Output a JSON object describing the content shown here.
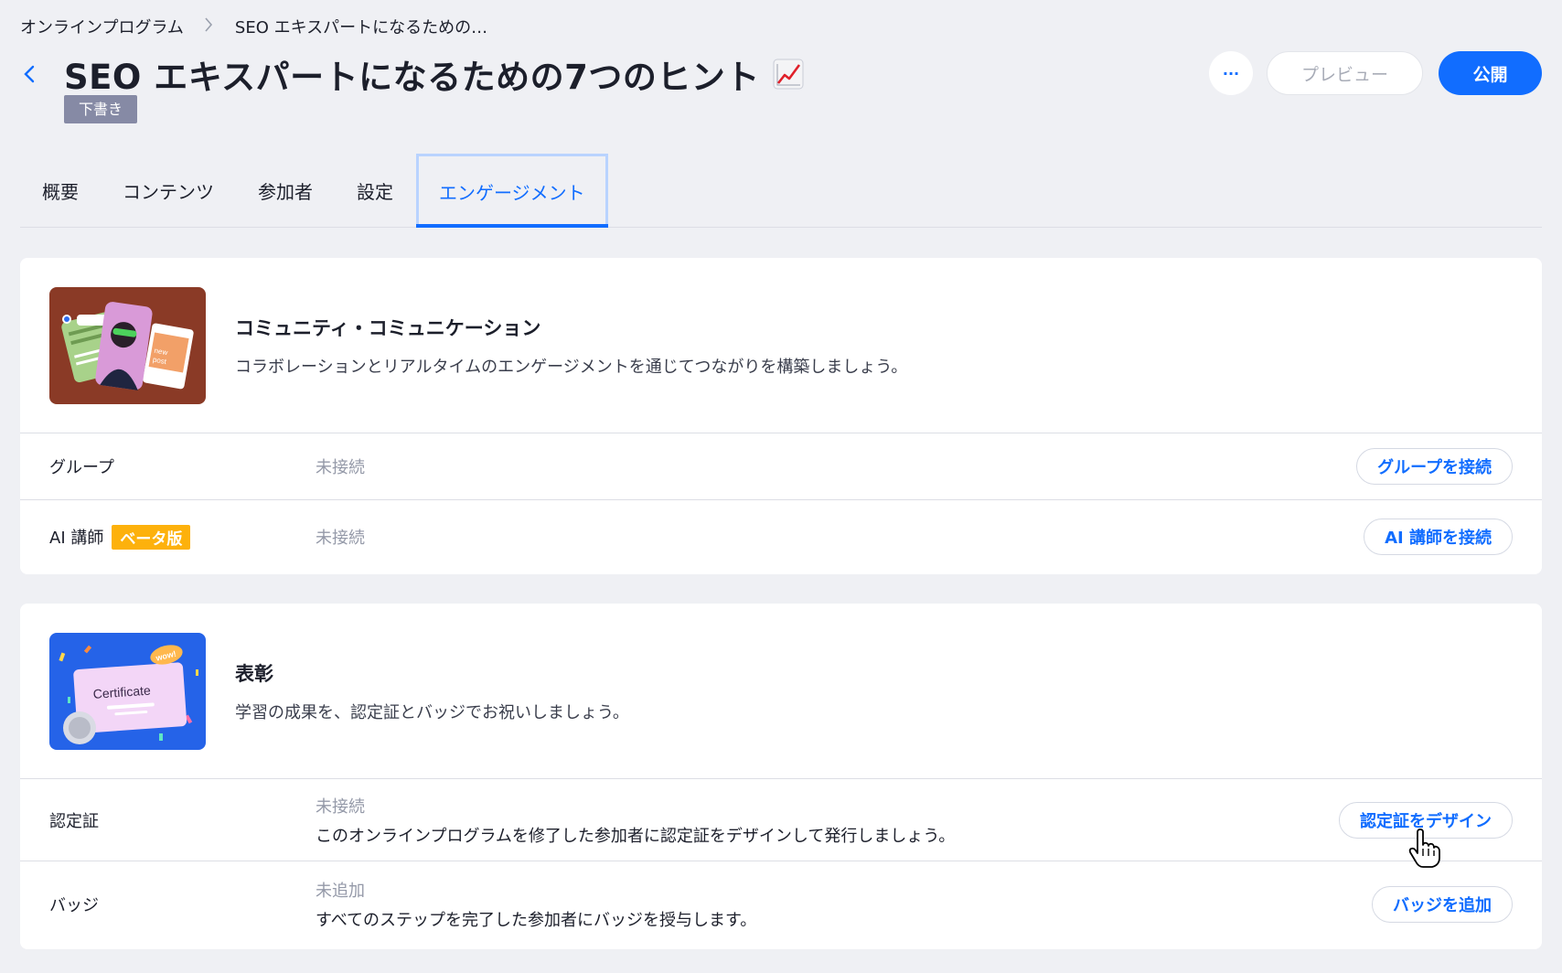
{
  "breadcrumb": {
    "root": "オンラインプログラム",
    "current": "SEO エキスパートになるための…"
  },
  "header": {
    "title": "SEO エキスパートになるための7つのヒント",
    "title_icon": "chart-increasing-emoji",
    "status_badge": "下書き",
    "more_label": "···",
    "preview_label": "プレビュー",
    "publish_label": "公開"
  },
  "tabs": [
    {
      "label": "概要",
      "active": false
    },
    {
      "label": "コンテンツ",
      "active": false
    },
    {
      "label": "参加者",
      "active": false
    },
    {
      "label": "設定",
      "active": false
    },
    {
      "label": "エンゲージメント",
      "active": true
    }
  ],
  "community": {
    "title": "コミュニティ・コミュニケーション",
    "description": "コラボレーションとリアルタイムのエンゲージメントを通じてつながりを構築しましょう。",
    "thumbnail": "community-collage-image",
    "rows": [
      {
        "label": "グループ",
        "badge": "",
        "status": "未接続",
        "button": "グループを接続"
      },
      {
        "label": "AI 講師",
        "badge": "ベータ版",
        "status": "未接続",
        "button": "AI 講師を接続"
      }
    ]
  },
  "recognition": {
    "title": "表彰",
    "description": "学習の成果を、認定証とバッジでお祝いしましょう。",
    "thumbnail": "certificate-image",
    "thumbnail_text": "Certificate",
    "thumbnail_sticker": "wow!",
    "rows": [
      {
        "label": "認定証",
        "status": "未接続",
        "detail": "このオンラインプログラムを修了した参加者に認定証をデザインして発行しましょう。",
        "button": "認定証をデザイン"
      },
      {
        "label": "バッジ",
        "status": "未追加",
        "detail": "すべてのステップを完了した参加者にバッジを授与します。",
        "button": "バッジを追加"
      }
    ]
  },
  "colors": {
    "accent": "#116dff",
    "background": "#eff0f4",
    "beta_badge": "#fdb10c",
    "draft_badge": "#868aa5"
  }
}
